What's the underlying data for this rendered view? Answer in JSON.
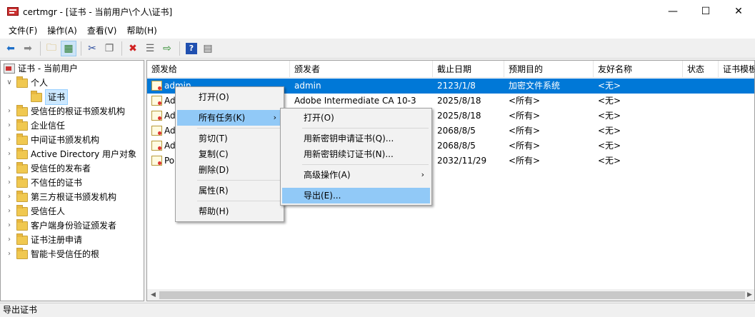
{
  "window": {
    "title": "certmgr - [证书 - 当前用户\\个人\\证书]",
    "minimize": "—",
    "maximize": "☐",
    "close": "✕"
  },
  "menubar": [
    "文件(F)",
    "操作(A)",
    "查看(V)",
    "帮助(H)"
  ],
  "tree": {
    "root": "证书 - 当前用户",
    "personal": "个人",
    "certs": "证书",
    "items": [
      "受信任的根证书颁发机构",
      "企业信任",
      "中间证书颁发机构",
      "Active Directory 用户对象",
      "受信任的发布者",
      "不信任的证书",
      "第三方根证书颁发机构",
      "受信任人",
      "客户端身份验证颁发者",
      "证书注册申请",
      "智能卡受信任的根"
    ]
  },
  "columns": [
    "颁发给",
    "颁发者",
    "截止日期",
    "预期目的",
    "友好名称",
    "状态",
    "证书模板"
  ],
  "rows": [
    [
      "admin",
      "admin",
      "2123/1/8",
      "加密文件系统",
      "<无>"
    ],
    [
      "Ad",
      "Adobe Intermediate CA 10-3",
      "2025/8/18",
      "<所有>",
      "<无>"
    ],
    [
      "Ad",
      "",
      "2025/8/18",
      "<所有>",
      "<无>"
    ],
    [
      "Ad",
      "",
      "2068/8/5",
      "<所有>",
      "<无>"
    ],
    [
      "Ad",
      "",
      "2068/8/5",
      "<所有>",
      "<无>"
    ],
    [
      "Po",
      "",
      "2032/11/29",
      "<所有>",
      "<无>"
    ]
  ],
  "context_menu": [
    "打开(O)",
    "所有任务(K)",
    "剪切(T)",
    "复制(C)",
    "删除(D)",
    "属性(R)",
    "帮助(H)"
  ],
  "submenu": [
    "打开(O)",
    "用新密钥申请证书(Q)...",
    "用新密钥续订证书(N)...",
    "高级操作(A)",
    "导出(E)..."
  ],
  "status": "导出证书",
  "colors": {
    "selection": "#0078d7",
    "menu_hover": "#91c9f7"
  }
}
